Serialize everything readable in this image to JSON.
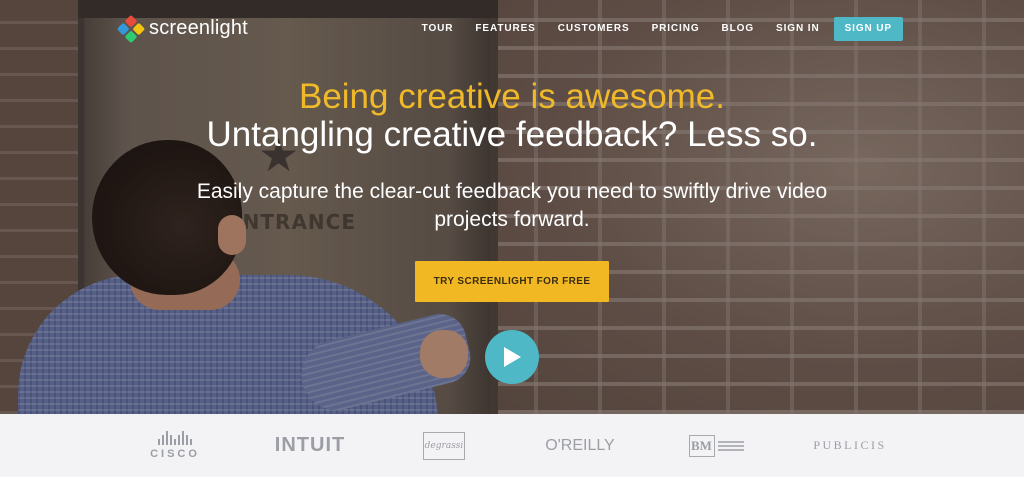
{
  "brand": {
    "name": "screenlight"
  },
  "nav": {
    "items": [
      "TOUR",
      "FEATURES",
      "CUSTOMERS",
      "PRICING",
      "BLOG",
      "SIGN IN"
    ],
    "signup_label": "SIGN UP"
  },
  "hero": {
    "headline_1": "Being creative is awesome.",
    "headline_2": "Untangling creative feedback? Less so.",
    "subhead": "Easily capture the clear-cut feedback you need to swiftly drive video projects forward.",
    "cta_label": "TRY SCREENLIGHT FOR FREE",
    "background_text": "ENTRANCE",
    "play_icon": "play-icon"
  },
  "clients": {
    "cisco": "CISCO",
    "intuit": "INTUIT",
    "degrassi": "degrassi",
    "oreilly": "O'REILLY",
    "bm": "BM",
    "publicis": "PUBLICIS"
  },
  "colors": {
    "accent_yellow": "#f2b824",
    "accent_teal": "#4fb8c7",
    "headline_yellow": "#f0b92a"
  }
}
